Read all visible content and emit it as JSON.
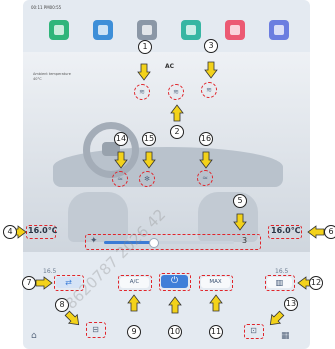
{
  "status_bar": {
    "time_text": "00:11  PM00:55"
  },
  "apps": [
    {
      "name": "phone",
      "color": "#2fb57a"
    },
    {
      "name": "car",
      "color": "#3e8fd8"
    },
    {
      "name": "settings",
      "color": "#8b97a6"
    },
    {
      "name": "navigation",
      "color": "#37b6a3"
    },
    {
      "name": "media",
      "color": "#ec5a73"
    },
    {
      "name": "bluetooth",
      "color": "#6b7de0"
    }
  ],
  "ac_panel": {
    "title": "AC",
    "ambient_label": "Ambient temperature",
    "ambient_value": "40°C"
  },
  "temperatures": {
    "left_small": "16.5",
    "right_small": "16.5",
    "left_set": "16.0℃",
    "right_set": "16.0℃"
  },
  "fan": {
    "level_text": "3",
    "level": 3,
    "max_level": 8
  },
  "buttons": {
    "recirculation": "⇄",
    "ac": "A/C",
    "power": "⏻",
    "max": "MAX",
    "rear_defrost": "▥"
  },
  "callouts": [
    "1",
    "2",
    "3",
    "4",
    "5",
    "6",
    "7",
    "8",
    "9",
    "10",
    "11",
    "12",
    "13",
    "14",
    "15",
    "16"
  ],
  "watermark": "8620787 2026 42"
}
